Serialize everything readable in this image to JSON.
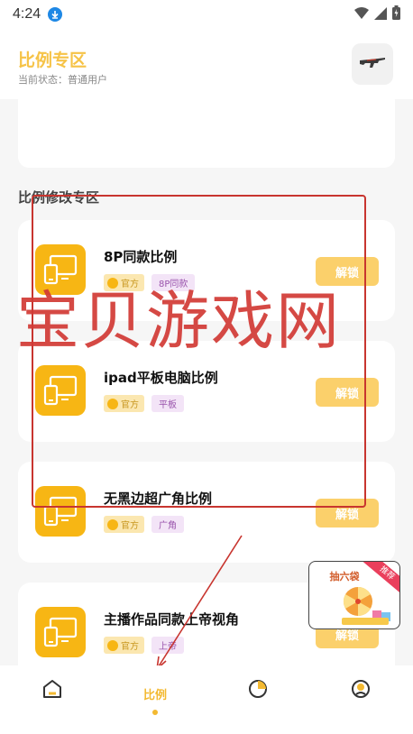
{
  "status_bar": {
    "time": "4:24"
  },
  "header": {
    "title": "比例专区",
    "status_label": "当前状态：普通用户"
  },
  "section": {
    "title": "比例修改专区"
  },
  "items": [
    {
      "name": "8P同款比例",
      "official_tag": "官方",
      "category_tag": "8P同款",
      "unlock_label": "解锁"
    },
    {
      "name": "ipad平板电脑比例",
      "official_tag": "官方",
      "category_tag": "平板",
      "unlock_label": "解锁"
    },
    {
      "name": "无黑边超广角比例",
      "official_tag": "官方",
      "category_tag": "广角",
      "unlock_label": "解锁"
    },
    {
      "name": "主播作品同款上帝视角",
      "official_tag": "官方",
      "category_tag": "上帝",
      "unlock_label": "解锁"
    }
  ],
  "promo": {
    "title": "抽六袋",
    "ribbon": "推荐"
  },
  "watermark": "宝贝游戏网",
  "tabbar": {
    "items": [
      {
        "name": "home"
      },
      {
        "name": "ratio",
        "label": "比例",
        "active": true
      },
      {
        "name": "stats"
      },
      {
        "name": "profile"
      }
    ]
  },
  "colors": {
    "accent": "#f3b931",
    "icon_bg": "#f7b614",
    "annotation_red": "#c8352f"
  }
}
